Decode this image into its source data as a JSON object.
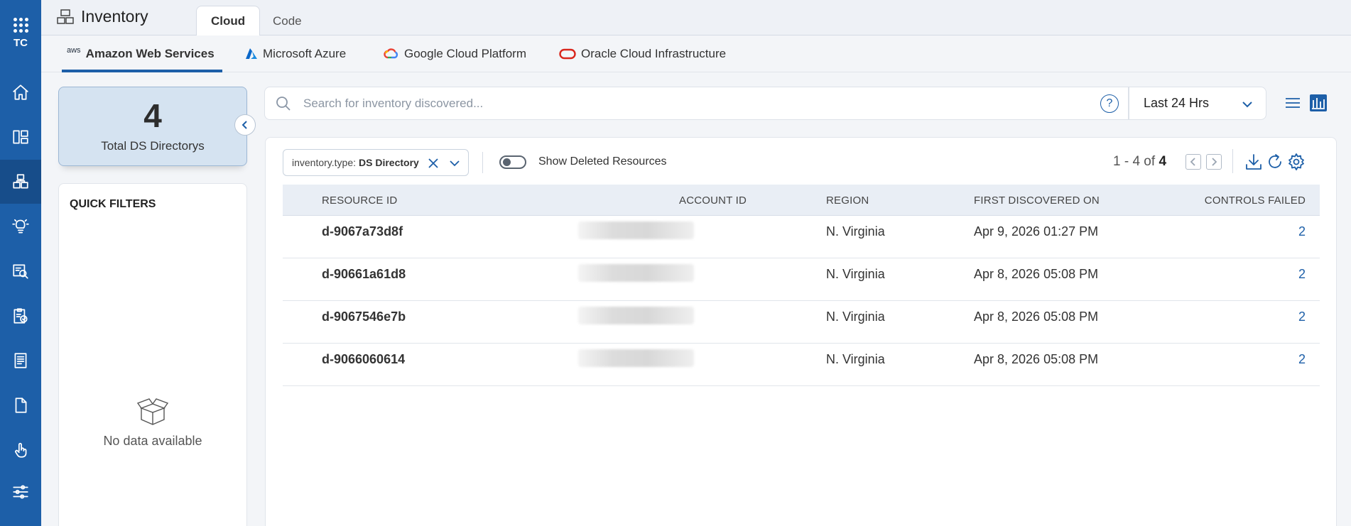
{
  "rail": {
    "initials": "TC",
    "items": [
      "home-icon",
      "dashboard-icon",
      "inventory-icon",
      "insights-icon",
      "search-inspect-icon",
      "compliance-icon",
      "reports-icon",
      "document-icon",
      "touch-icon",
      "settings-sliders-icon"
    ],
    "active_index": 2
  },
  "header": {
    "title": "Inventory",
    "tabs": [
      {
        "label": "Cloud",
        "active": true
      },
      {
        "label": "Code",
        "active": false
      }
    ]
  },
  "providers": [
    {
      "label": "Amazon Web Services",
      "logo": "aws",
      "active": true
    },
    {
      "label": "Microsoft Azure",
      "logo": "azure",
      "active": false
    },
    {
      "label": "Google Cloud Platform",
      "logo": "gcp",
      "active": false
    },
    {
      "label": "Oracle Cloud Infrastructure",
      "logo": "oracle",
      "active": false
    }
  ],
  "summary": {
    "count": "4",
    "label": "Total DS Directorys"
  },
  "quick_filters": {
    "title": "QUICK FILTERS",
    "empty_text": "No data available"
  },
  "search": {
    "placeholder": "Search for inventory discovered...",
    "help": "?"
  },
  "time_range": "Last 24 Hrs",
  "filter_chip": {
    "key": "inventory.type:",
    "value": "DS Directory"
  },
  "show_deleted": {
    "label": "Show Deleted Resources",
    "on": false
  },
  "pager": {
    "range": "1 - 4 of",
    "total": "4"
  },
  "table": {
    "columns": [
      "RESOURCE ID",
      "ACCOUNT ID",
      "REGION",
      "FIRST DISCOVERED ON",
      "CONTROLS FAILED"
    ],
    "rows": [
      {
        "resource_id": "d-9067a73d8f",
        "region": "N. Virginia",
        "first_discovered": "Apr 9, 2026 01:27 PM",
        "controls_failed": "2"
      },
      {
        "resource_id": "d-90661a61d8",
        "region": "N. Virginia",
        "first_discovered": "Apr 8, 2026 05:08 PM",
        "controls_failed": "2"
      },
      {
        "resource_id": "d-9067546e7b",
        "region": "N. Virginia",
        "first_discovered": "Apr 8, 2026 05:08 PM",
        "controls_failed": "2"
      },
      {
        "resource_id": "d-9066060614",
        "region": "N. Virginia",
        "first_discovered": "Apr 8, 2026 05:08 PM",
        "controls_failed": "2"
      }
    ]
  },
  "colors": {
    "brand": "#1d5fa8",
    "rail_active": "#174d8a",
    "summary_bg": "#d5e3f1"
  }
}
